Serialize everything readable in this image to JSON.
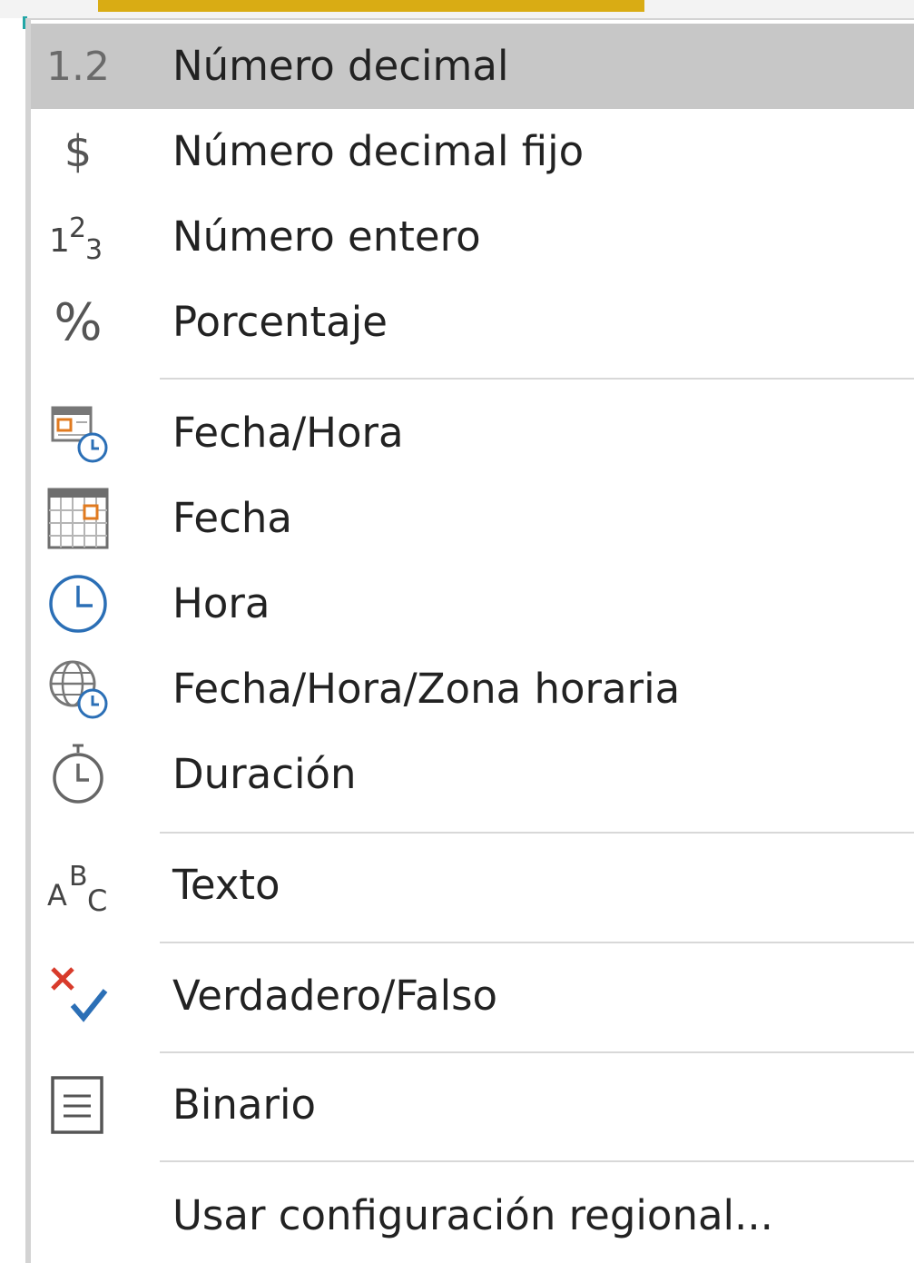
{
  "menu": {
    "items": [
      {
        "label": "Número decimal",
        "icon": "decimal-number-icon",
        "icon_text": "1.2",
        "hovered": true
      },
      {
        "label": "Número decimal fijo",
        "icon": "currency-icon",
        "icon_text": "$"
      },
      {
        "label": "Número entero",
        "icon": "whole-number-icon",
        "icon_text": ""
      },
      {
        "label": "Porcentaje",
        "icon": "percent-icon",
        "icon_text": "%"
      },
      {
        "label": "Fecha/Hora",
        "icon": "datetime-icon"
      },
      {
        "label": "Fecha",
        "icon": "date-icon"
      },
      {
        "label": "Hora",
        "icon": "time-icon"
      },
      {
        "label": "Fecha/Hora/Zona horaria",
        "icon": "datetime-timezone-icon"
      },
      {
        "label": "Duración",
        "icon": "duration-icon"
      },
      {
        "label": "Texto",
        "icon": "text-icon"
      },
      {
        "label": "Verdadero/Falso",
        "icon": "true-false-icon"
      },
      {
        "label": "Binario",
        "icon": "binary-icon"
      },
      {
        "label": "Usar configuración regional...",
        "icon": ""
      }
    ]
  },
  "colors": {
    "hover_bg": "#c7c7c7",
    "accent_yellow": "#d9ac14",
    "icon_gray": "#555555",
    "icon_blue": "#2b6fb6",
    "icon_orange": "#e07a1f",
    "icon_red": "#d83b2b"
  }
}
